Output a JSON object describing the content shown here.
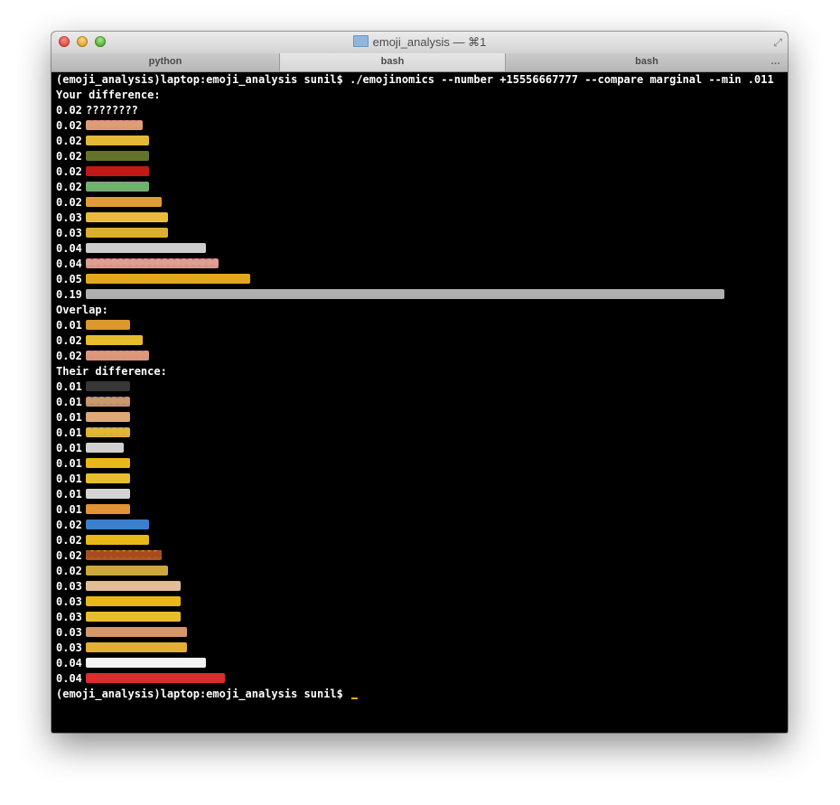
{
  "window": {
    "title": "emoji_analysis — ⌘1",
    "folder_icon": "folder-icon",
    "fullscreen_icon": "fullscreen-icon"
  },
  "tabs": [
    {
      "label": "python",
      "active": false
    },
    {
      "label": "bash",
      "active": true
    },
    {
      "label": "bash",
      "active": false,
      "more": "…"
    }
  ],
  "terminal": {
    "command": "(emoji_analysis)laptop:emoji_analysis sunil$ ./emojinomics --number +15556667777 --compare marginal --min .011",
    "sections": [
      {
        "heading": "Your difference:",
        "rows": [
          {
            "value": "0.02",
            "text": "????????"
          },
          {
            "value": "0.02",
            "count": 9,
            "color": "#e9a77a",
            "accent": "#d878a0"
          },
          {
            "value": "0.02",
            "count": 10,
            "color": "#f0c23a"
          },
          {
            "value": "0.02",
            "count": 10,
            "color": "#6a7a2c"
          },
          {
            "value": "0.02",
            "count": 10,
            "color": "#cc1a1a"
          },
          {
            "value": "0.02",
            "count": 10,
            "color": "#6fbf6f",
            "accent": "#d070c0"
          },
          {
            "value": "0.02",
            "count": 12,
            "color": "#f0a43a"
          },
          {
            "value": "0.03",
            "count": 13,
            "color": "#f7c444"
          },
          {
            "value": "0.03",
            "count": 13,
            "color": "#e8b830"
          },
          {
            "value": "0.04",
            "count": 19,
            "color": "#d9d9d9"
          },
          {
            "value": "0.04",
            "count": 21,
            "color": "#e8a898",
            "accent": "#c8506e"
          },
          {
            "value": "0.05",
            "count": 26,
            "color": "#f0b020"
          },
          {
            "value": "0.19",
            "count": 101,
            "color": "#b8b8b8"
          }
        ]
      },
      {
        "heading": "Overlap:",
        "rows": [
          {
            "value": "0.01",
            "count": 7,
            "color": "#e8a030"
          },
          {
            "value": "0.02",
            "count": 9,
            "color": "#f5c830"
          },
          {
            "value": "0.02",
            "count": 10,
            "color": "#e8a080",
            "accent": "#d878a0"
          }
        ]
      },
      {
        "heading": "Their difference:",
        "rows": [
          {
            "value": "0.01",
            "count": 7,
            "color": "#3a3a3a"
          },
          {
            "value": "0.01",
            "count": 7,
            "color": "#d9a070",
            "accent": "#4a6aa0"
          },
          {
            "value": "0.01",
            "count": 7,
            "color": "#e8b080"
          },
          {
            "value": "0.01",
            "count": 7,
            "color": "#f0c030",
            "accent": "#6aa0e0"
          },
          {
            "value": "0.01",
            "count": 6,
            "color": "#dcdcdc"
          },
          {
            "value": "0.01",
            "count": 7,
            "color": "#f5c21a"
          },
          {
            "value": "0.01",
            "count": 7,
            "color": "#f5c830"
          },
          {
            "value": "0.01",
            "count": 7,
            "color": "#e0e0e0"
          },
          {
            "value": "0.01",
            "count": 7,
            "color": "#f09a3a"
          },
          {
            "value": "0.02",
            "count": 10,
            "color": "#3f86d8"
          },
          {
            "value": "0.02",
            "count": 10,
            "color": "#f5c21a"
          },
          {
            "value": "0.02",
            "count": 12,
            "color": "#b05020",
            "accent": "#f0a030"
          },
          {
            "value": "0.02",
            "count": 13,
            "color": "#d8b040"
          },
          {
            "value": "0.03",
            "count": 15,
            "color": "#f0c8a0"
          },
          {
            "value": "0.03",
            "count": 15,
            "color": "#f5c21a"
          },
          {
            "value": "0.03",
            "count": 15,
            "color": "#f5c830"
          },
          {
            "value": "0.03",
            "count": 16,
            "color": "#e0a070"
          },
          {
            "value": "0.03",
            "count": 16,
            "color": "#f0b838"
          },
          {
            "value": "0.04",
            "count": 19,
            "color": "#ffffff"
          },
          {
            "value": "0.04",
            "count": 22,
            "color": "#e83030"
          }
        ]
      }
    ],
    "prompt": "(emoji_analysis)laptop:emoji_analysis sunil$ "
  }
}
